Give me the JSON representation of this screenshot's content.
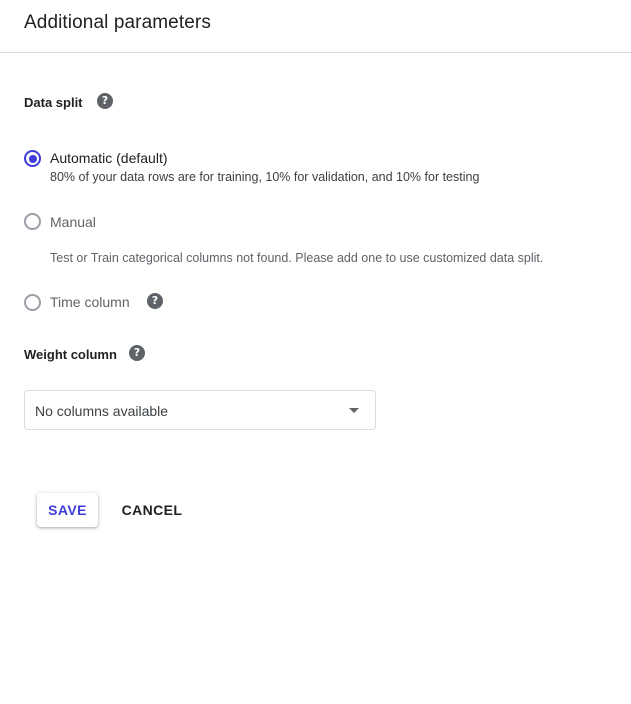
{
  "header": {
    "title": "Additional parameters"
  },
  "data_split": {
    "label": "Data split",
    "help_icon": "help-icon",
    "options": [
      {
        "label": "Automatic (default)",
        "description": "80% of your data rows are for training, 10% for validation, and 10% for testing",
        "selected": true
      },
      {
        "label": "Manual",
        "description": "Test or Train categorical columns not found. Please add one to use customized data split.",
        "selected": false
      },
      {
        "label": "Time column",
        "selected": false
      }
    ]
  },
  "weight_column": {
    "label": "Weight column",
    "help_icon": "help-icon",
    "select_value": "No columns available"
  },
  "actions": {
    "save_label": "SAVE",
    "cancel_label": "CANCEL"
  },
  "colors": {
    "accent": "#3f3cdb",
    "divider": "#dadce0",
    "icon": "#5f6368"
  }
}
